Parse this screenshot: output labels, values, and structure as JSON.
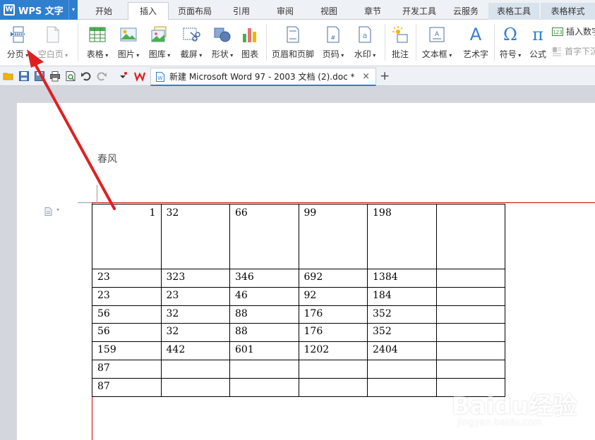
{
  "app": {
    "title": "WPS 文字",
    "dropdown_arrow": "▾"
  },
  "menu": {
    "tabs": [
      "开始",
      "插入",
      "页面布局",
      "引用",
      "审阅",
      "视图",
      "章节",
      "开发工具",
      "云服务",
      "表格工具",
      "表格样式"
    ],
    "active": "插入"
  },
  "ribbon": {
    "page_break": "分页",
    "blank_page": "空白页",
    "table": "表格",
    "picture": "图片",
    "gallery": "图库",
    "screenshot": "截屏",
    "shape": "形状",
    "chart": "图表",
    "header_footer": "页眉和页脚",
    "page_number": "页码",
    "watermark": "水印",
    "comment": "批注",
    "textbox": "文本框",
    "wordart": "艺术字",
    "symbol": "符号",
    "equation": "公式",
    "insert_number": "插入数字",
    "drop_cap": "首字下沉",
    "symbol_glyph": "Ω",
    "equation_glyph": "π",
    "wordart_glyph": "A"
  },
  "doc_tab": {
    "title": "新建 Microsoft Word 97 - 2003 文档 (2).doc *",
    "close": "×",
    "add": "+"
  },
  "document": {
    "header_text": "春风",
    "table": [
      [
        "1",
        "32",
        "66",
        "99",
        "198",
        ""
      ],
      [
        "23",
        "323",
        "346",
        "692",
        "1384",
        ""
      ],
      [
        "23",
        "23",
        "46",
        "92",
        "184",
        ""
      ],
      [
        "56",
        "32",
        "88",
        "176",
        "352",
        ""
      ],
      [
        "56",
        "32",
        "88",
        "176",
        "352",
        ""
      ],
      [
        "159",
        "442",
        "601",
        "1202",
        "2404",
        ""
      ],
      [
        "87",
        "",
        "",
        "",
        "",
        ""
      ],
      [
        "87",
        "",
        "",
        "",
        "",
        ""
      ]
    ]
  },
  "watermark": {
    "brand": "Baidu经验",
    "url": "jingyan.baidu.com"
  },
  "colors": {
    "accent": "#2f7fd0",
    "arrow": "#e02020",
    "margin": "#cc0000"
  }
}
